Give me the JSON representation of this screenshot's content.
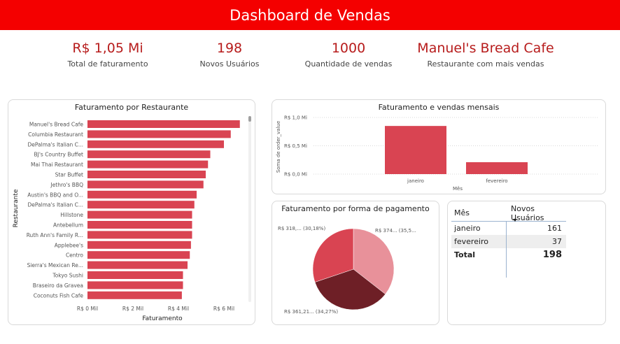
{
  "header": {
    "title": "Dashboard de Vendas"
  },
  "kpis": [
    {
      "value": "R$ 1,05 Mi",
      "label": "Total de faturamento"
    },
    {
      "value": "198",
      "label": "Novos Usuários"
    },
    {
      "value": "1000",
      "label": "Quantidade de vendas"
    },
    {
      "value": "Manuel's Bread Cafe",
      "label": "Restaurante com mais vendas"
    }
  ],
  "colors": {
    "header": "#f40000",
    "bar": "#d94452",
    "kpi": "#b71c1c"
  },
  "chart_data": [
    {
      "type": "bar",
      "orientation": "horizontal",
      "title": "Faturamento por Restaurante",
      "xlabel": "Faturamento",
      "ylabel": "Restaurante",
      "xlim": [
        0,
        6.8
      ],
      "xticks": [
        "R$ 0 Mil",
        "R$ 2 Mil",
        "R$ 4 Mil",
        "R$ 6 Mil"
      ],
      "xtick_values": [
        0,
        2,
        4,
        6
      ],
      "categories": [
        "Manuel's Bread Cafe",
        "Columbia Restaurant",
        "DePalma's Italian C...",
        "BJ's Country Buffet",
        "Mai Thai Restaurant",
        "Star Buffet",
        "Jethro's BBQ",
        "Austin's BBQ and O...",
        "DePalma's Italian C...",
        "Hillstone",
        "Antebellum",
        "Ruth Ann's Family R...",
        "Applebee's",
        "Centro",
        "Sierra's Mexican Re...",
        "Tokyo Sushi",
        "Braseiro da Gravea",
        "Coconuts Fish Cafe"
      ],
      "values": [
        6.7,
        6.3,
        6.0,
        5.4,
        5.3,
        5.2,
        5.1,
        4.8,
        4.7,
        4.6,
        4.6,
        4.6,
        4.55,
        4.5,
        4.4,
        4.2,
        4.2,
        4.15
      ]
    },
    {
      "type": "bar",
      "title": "Faturamento e vendas mensais",
      "xlabel": "Mês",
      "ylabel": "Soma de order_value",
      "categories": [
        "janeiro",
        "fevereiro"
      ],
      "values": [
        0.85,
        0.21
      ],
      "ylim": [
        0,
        1.0
      ],
      "yticks": [
        "R$ 0,0 Mi",
        "R$ 0,5 Mi",
        "R$ 1,0 Mi"
      ],
      "ytick_values": [
        0,
        0.5,
        1.0
      ],
      "grid": true
    },
    {
      "type": "pie",
      "title": "Faturamento por forma de pagamento",
      "slices": [
        {
          "label": "R$ 374... (35,5...",
          "value": 35.55,
          "color": "#e8919a"
        },
        {
          "label": "R$ 361,21... (34,27%)",
          "value": 34.27,
          "color": "#6e1f26"
        },
        {
          "label": "R$ 318,... (30,18%)",
          "value": 30.18,
          "color": "#d94452"
        }
      ]
    }
  ],
  "table": {
    "columns": [
      "Mês",
      "Novos Usuários"
    ],
    "rows": [
      {
        "month": "janeiro",
        "users": "161"
      },
      {
        "month": "fevereiro",
        "users": "37"
      }
    ],
    "total": {
      "label": "Total",
      "value": "198"
    }
  }
}
